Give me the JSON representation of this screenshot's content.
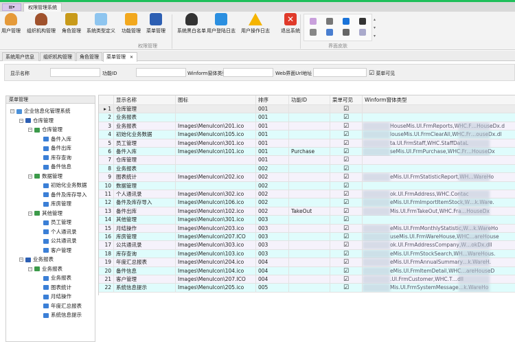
{
  "app": {
    "title_tab": "权限管理系统",
    "app_button": "▤▾",
    "accent": "#1fbf5a"
  },
  "ribbon": {
    "buttons": [
      {
        "label": "用户管理",
        "icon": "user-icon",
        "color": "#e59a3a"
      },
      {
        "label": "组织机构管理",
        "icon": "group-icon",
        "color": "#a0522d"
      },
      {
        "label": "角色管理",
        "icon": "role-key-icon",
        "color": "#c89a1a"
      },
      {
        "label": "系统类型定义",
        "icon": "computers-icon",
        "color": "#8ec5ef"
      },
      {
        "label": "功能管理",
        "icon": "key-icon",
        "color": "#f2a81e"
      },
      {
        "label": "菜单管理",
        "icon": "menu-book-icon",
        "color": "#2d5fb3"
      },
      {
        "label": "系统黑白名单",
        "icon": "person-silhouette-icon",
        "color": "#333333"
      },
      {
        "label": "用户登陆日志",
        "icon": "checklist-icon",
        "color": "#2b8fe0"
      },
      {
        "label": "用户操作日志",
        "icon": "warning-icon",
        "color": "#f5b400"
      },
      {
        "label": "退出系统",
        "icon": "close-icon",
        "color": "#e03a2a"
      }
    ],
    "group_labels": [
      "权限管理",
      "界面皮肤"
    ]
  },
  "doc_tabs": [
    {
      "label": "系统用户信息"
    },
    {
      "label": "组织机构管理"
    },
    {
      "label": "角色管理"
    },
    {
      "label": "菜单管理",
      "active": true,
      "close": "✕"
    }
  ],
  "filter": {
    "labels": [
      "显示名称",
      "功能ID",
      "Winform窗体类型",
      "Web界面Url地址"
    ],
    "values": [
      "",
      "",
      "",
      ""
    ],
    "checkbox_label": "菜单可见",
    "checked": true
  },
  "left_panel": {
    "title": "菜单管理",
    "tree": [
      {
        "label": "企业信息化管理系统",
        "level": 0,
        "toggle": "−"
      },
      {
        "label": "仓库管理",
        "level": 1,
        "toggle": "−"
      },
      {
        "label": "仓库管理",
        "level": 2,
        "toggle": "−"
      },
      {
        "label": "备件入库",
        "level": 3
      },
      {
        "label": "备件出库",
        "level": 3
      },
      {
        "label": "库存查询",
        "level": 3
      },
      {
        "label": "备件信息",
        "level": 3
      },
      {
        "label": "数据管理",
        "level": 2,
        "toggle": "−"
      },
      {
        "label": "初始化业务数据",
        "level": 3
      },
      {
        "label": "备件及库存导入",
        "level": 3
      },
      {
        "label": "库房管理",
        "level": 3
      },
      {
        "label": "其他管理",
        "level": 2,
        "toggle": "−"
      },
      {
        "label": "员工管理",
        "level": 3
      },
      {
        "label": "个人通讯录",
        "level": 3
      },
      {
        "label": "公共通讯录",
        "level": 3
      },
      {
        "label": "客户管理",
        "level": 3
      },
      {
        "label": "业务报表",
        "level": 1,
        "toggle": "−"
      },
      {
        "label": "业务报表",
        "level": 2,
        "toggle": "−"
      },
      {
        "label": "业务报表",
        "level": 3
      },
      {
        "label": "图表统计",
        "level": 3
      },
      {
        "label": "月结操作",
        "level": 3
      },
      {
        "label": "年度汇总报表",
        "level": 3
      },
      {
        "label": "系统信息提示",
        "level": 3
      }
    ]
  },
  "grid": {
    "columns": [
      "",
      "显示名称",
      "图标",
      "排序",
      "功能ID",
      "菜单可见",
      "Winform窗体类型"
    ],
    "check_glyph": "☑",
    "row_colors": [
      "#f5f2fb",
      "#dffcfc"
    ],
    "rows": [
      {
        "n": "1",
        "name": "仓库管理",
        "icon": "",
        "sort": "001",
        "fid": "",
        "win": ""
      },
      {
        "n": "2",
        "name": "业务报表",
        "icon": "",
        "sort": "001",
        "fid": "",
        "win": ""
      },
      {
        "n": "3",
        "name": "业务报表",
        "icon": "Images\\MenuIcon\\201.ico",
        "sort": "001",
        "fid": "",
        "win": "HouseMis.UI.FrmReports,WHC.F…HouseDx.d"
      },
      {
        "n": "4",
        "name": "初始化业务数据",
        "icon": "Images\\MenuIcon\\105.ico",
        "sort": "001",
        "fid": "",
        "win": "louseMis.UI.FrmClearAll,WHC.Fr…ouseDx.dl"
      },
      {
        "n": "5",
        "name": "员工管理",
        "icon": "Images\\MenuIcon\\301.ico",
        "sort": "001",
        "fid": "",
        "win": "ta.UI.FrmStaff,WHC.StaffDataL"
      },
      {
        "n": "6",
        "name": "备件入库",
        "icon": "Images\\MenuIcon\\101.ico",
        "sort": "001",
        "fid": "Purchase",
        "win": "seMis.UI.FrmPurchase,WHC.Fr…HouseDx"
      },
      {
        "n": "7",
        "name": "仓库管理",
        "icon": "",
        "sort": "001",
        "fid": "",
        "win": ""
      },
      {
        "n": "8",
        "name": "业务报表",
        "icon": "",
        "sort": "002",
        "fid": "",
        "win": ""
      },
      {
        "n": "9",
        "name": "图表统计",
        "icon": "Images\\MenuIcon\\202.ico",
        "sort": "002",
        "fid": "",
        "win": "eMis.UI.FrmStatisticReport,WH…WareHo"
      },
      {
        "n": "10",
        "name": "数据管理",
        "icon": "",
        "sort": "002",
        "fid": "",
        "win": ""
      },
      {
        "n": "11",
        "name": "个人通讯录",
        "icon": "Images\\MenuIcon\\302.ico",
        "sort": "002",
        "fid": "",
        "win": "ok.UI.FrmAddress,WHC.Contac"
      },
      {
        "n": "12",
        "name": "备件及库存导入",
        "icon": "Images\\MenuIcon\\106.ico",
        "sort": "002",
        "fid": "",
        "win": "eMis.UI.FrmImportItemStock,W…k.Ware."
      },
      {
        "n": "13",
        "name": "备件出库",
        "icon": "Images\\MenuIcon\\102.ico",
        "sort": "002",
        "fid": "TakeOut",
        "win": "Mis.UI.FrmTakeOut,WHC.Fra…HouseDx"
      },
      {
        "n": "14",
        "name": "其他管理",
        "icon": "Images\\MenuIcon\\301.ico",
        "sort": "003",
        "fid": "",
        "win": ""
      },
      {
        "n": "15",
        "name": "月结操作",
        "icon": "Images\\MenuIcon\\203.ico",
        "sort": "003",
        "fid": "",
        "win": "eMis.UI.FrmMonthlyStatistic,W…k.WareHo"
      },
      {
        "n": "16",
        "name": "库房管理",
        "icon": "Images\\MenuIcon\\207.ICO",
        "sort": "003",
        "fid": "",
        "win": "useMis.UI.FrmWareHouse,WHC…areHouse"
      },
      {
        "n": "17",
        "name": "公共通讯录",
        "icon": "Images\\MenuIcon\\303.ico",
        "sort": "003",
        "fid": "",
        "win": "ok.UI.FrmAddressCompany,W…okDx.dll"
      },
      {
        "n": "18",
        "name": "库存查询",
        "icon": "Images\\MenuIcon\\103.ico",
        "sort": "003",
        "fid": "",
        "win": "eMis.UI.FrmStockSearch,WH…WareHous."
      },
      {
        "n": "19",
        "name": "年度汇总报表",
        "icon": "Images\\MenuIcon\\204.ico",
        "sort": "004",
        "fid": "",
        "win": "eMis.UI.FrmAnnualSummary…k.WareH."
      },
      {
        "n": "20",
        "name": "备件信息",
        "icon": "Images\\MenuIcon\\104.ico",
        "sort": "004",
        "fid": "",
        "win": "eMis.UI.FrmItemDetail,WHC…areHouseD"
      },
      {
        "n": "21",
        "name": "客户管理",
        "icon": "Images\\MenuIcon\\207.ICO",
        "sort": "004",
        "fid": "",
        "win": ".UI.FrmCustomer,WHC.T…dll"
      },
      {
        "n": "22",
        "name": "系统信息提示",
        "icon": "Images\\MenuIcon\\205.ico",
        "sort": "005",
        "fid": "",
        "win": "Mis.UI.FrmSystemMessage…k.WareHo"
      }
    ]
  }
}
